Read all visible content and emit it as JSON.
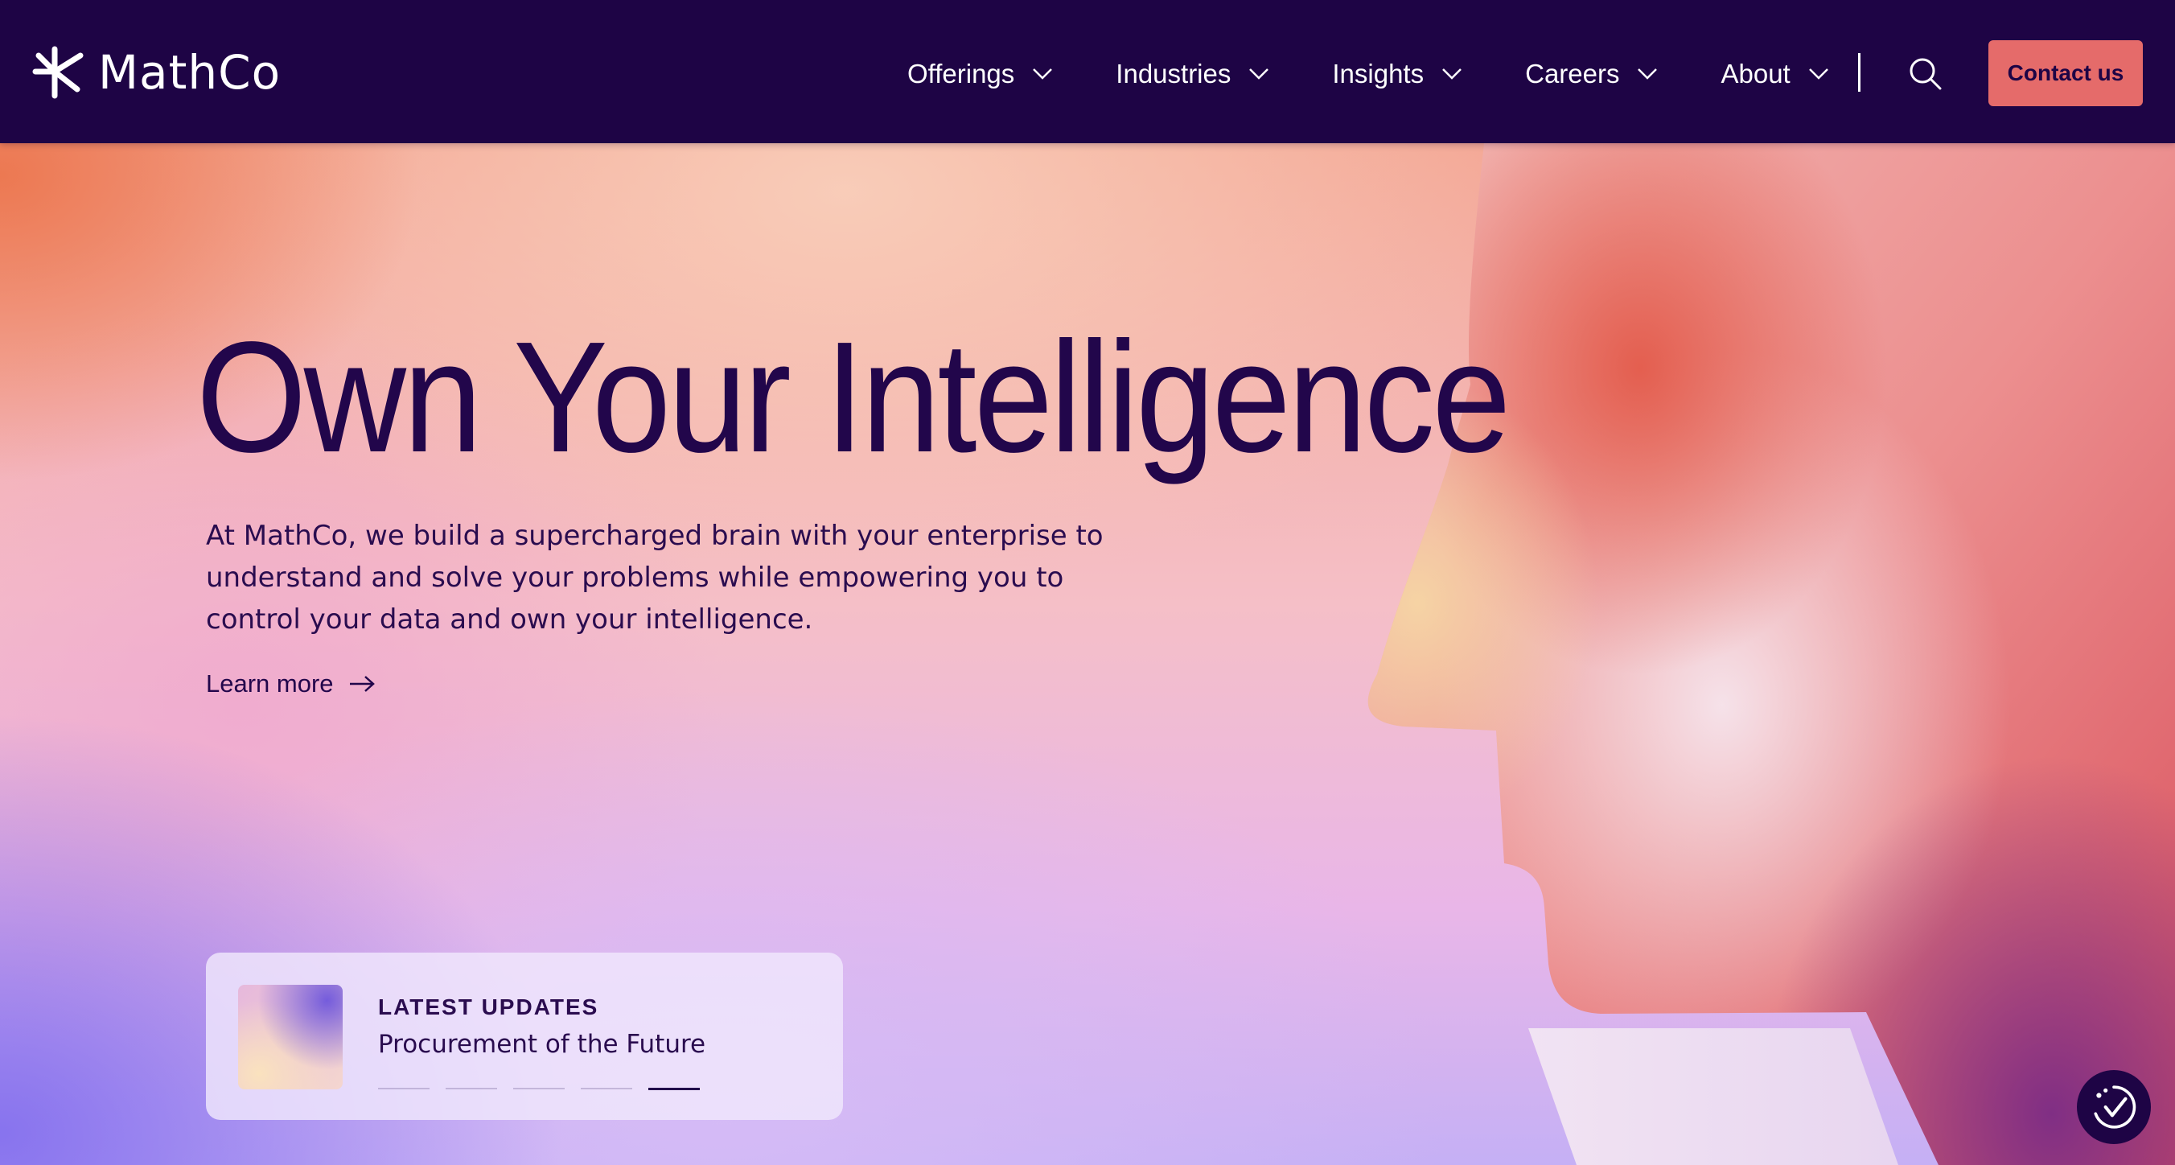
{
  "header": {
    "logo_text": "MathCo",
    "nav": [
      {
        "label": "Offerings"
      },
      {
        "label": "Industries"
      },
      {
        "label": "Insights"
      },
      {
        "label": "Careers"
      },
      {
        "label": "About"
      }
    ],
    "contact_label": "Contact us"
  },
  "hero": {
    "title": "Own Your Intelligence",
    "description": "At MathCo, we build a supercharged brain with your enterprise to understand and solve your problems while empowering you to control your data and own your intelligence.",
    "learn_more_label": "Learn more"
  },
  "updates": {
    "kicker": "LATEST UPDATES",
    "title": "Procurement of the Future",
    "slide_count": 5,
    "active_slide": 5
  },
  "colors": {
    "header_bg": "#1e0445",
    "accent": "#e56b6a",
    "text_dark": "#22064b"
  },
  "icons": {
    "logo": "asterisk-logo-icon",
    "chevron": "chevron-down-icon",
    "search": "search-icon",
    "learn_more": "arrow-right-icon",
    "widget": "accessibility-check-icon"
  }
}
